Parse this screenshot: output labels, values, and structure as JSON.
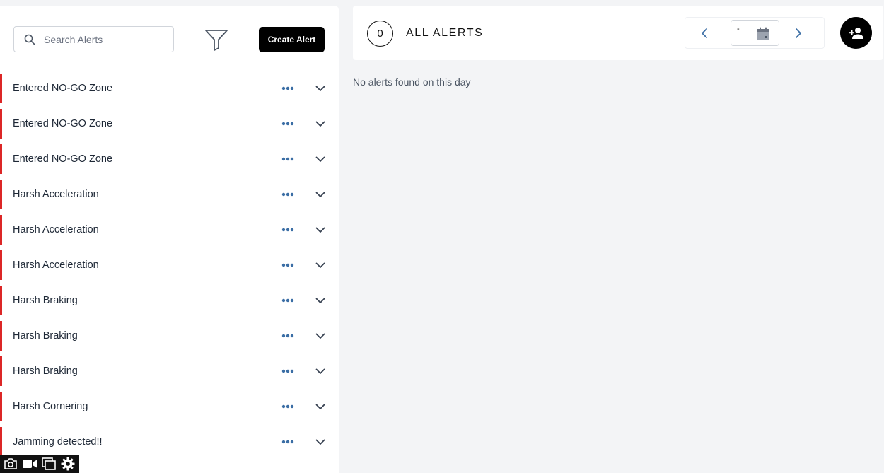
{
  "sidebar": {
    "search": {
      "placeholder": "Search Alerts",
      "value": ""
    },
    "filter_icon": "filter-icon",
    "create_button_label": "Create Alert",
    "alerts": [
      {
        "label": "Entered NO-GO Zone"
      },
      {
        "label": "Entered NO-GO Zone"
      },
      {
        "label": "Entered NO-GO Zone"
      },
      {
        "label": "Harsh Acceleration"
      },
      {
        "label": "Harsh Acceleration"
      },
      {
        "label": "Harsh Acceleration"
      },
      {
        "label": "Harsh Braking"
      },
      {
        "label": "Harsh Braking"
      },
      {
        "label": "Harsh Braking"
      },
      {
        "label": "Harsh Cornering"
      },
      {
        "label": "Jamming detected!!"
      }
    ],
    "alert_status_color": "#dc2626",
    "action_icon_color": "#3b6ea5"
  },
  "header": {
    "count": "0",
    "title": "ALL ALERTS",
    "date_value": "-",
    "prev_icon": "chevron-left-icon",
    "next_icon": "chevron-right-icon",
    "calendar_icon": "calendar-icon",
    "add_user_icon": "add-user-icon"
  },
  "main": {
    "empty_message": "No alerts found on this day"
  },
  "toolbar": {
    "items": [
      "camera-icon",
      "video-icon",
      "window-icon",
      "gear-icon"
    ]
  }
}
